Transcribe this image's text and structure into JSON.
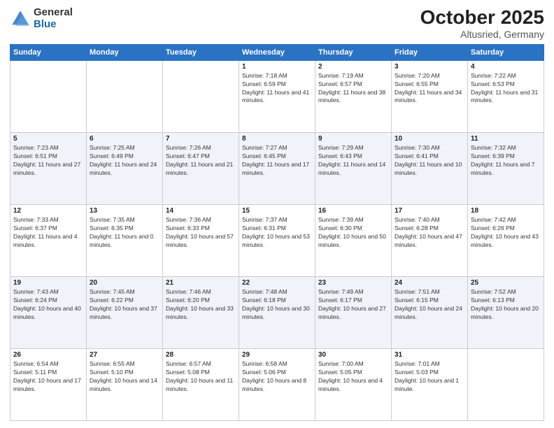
{
  "logo": {
    "general": "General",
    "blue": "Blue"
  },
  "title": {
    "month": "October 2025",
    "location": "Altusried, Germany"
  },
  "weekdays": [
    "Sunday",
    "Monday",
    "Tuesday",
    "Wednesday",
    "Thursday",
    "Friday",
    "Saturday"
  ],
  "weeks": [
    [
      {
        "day": "",
        "sunrise": "",
        "sunset": "",
        "daylight": ""
      },
      {
        "day": "",
        "sunrise": "",
        "sunset": "",
        "daylight": ""
      },
      {
        "day": "",
        "sunrise": "",
        "sunset": "",
        "daylight": ""
      },
      {
        "day": "1",
        "sunrise": "Sunrise: 7:18 AM",
        "sunset": "Sunset: 6:59 PM",
        "daylight": "Daylight: 11 hours and 41 minutes."
      },
      {
        "day": "2",
        "sunrise": "Sunrise: 7:19 AM",
        "sunset": "Sunset: 6:57 PM",
        "daylight": "Daylight: 11 hours and 38 minutes."
      },
      {
        "day": "3",
        "sunrise": "Sunrise: 7:20 AM",
        "sunset": "Sunset: 6:55 PM",
        "daylight": "Daylight: 11 hours and 34 minutes."
      },
      {
        "day": "4",
        "sunrise": "Sunrise: 7:22 AM",
        "sunset": "Sunset: 6:53 PM",
        "daylight": "Daylight: 11 hours and 31 minutes."
      }
    ],
    [
      {
        "day": "5",
        "sunrise": "Sunrise: 7:23 AM",
        "sunset": "Sunset: 6:51 PM",
        "daylight": "Daylight: 11 hours and 27 minutes."
      },
      {
        "day": "6",
        "sunrise": "Sunrise: 7:25 AM",
        "sunset": "Sunset: 6:49 PM",
        "daylight": "Daylight: 11 hours and 24 minutes."
      },
      {
        "day": "7",
        "sunrise": "Sunrise: 7:26 AM",
        "sunset": "Sunset: 6:47 PM",
        "daylight": "Daylight: 11 hours and 21 minutes."
      },
      {
        "day": "8",
        "sunrise": "Sunrise: 7:27 AM",
        "sunset": "Sunset: 6:45 PM",
        "daylight": "Daylight: 11 hours and 17 minutes."
      },
      {
        "day": "9",
        "sunrise": "Sunrise: 7:29 AM",
        "sunset": "Sunset: 6:43 PM",
        "daylight": "Daylight: 11 hours and 14 minutes."
      },
      {
        "day": "10",
        "sunrise": "Sunrise: 7:30 AM",
        "sunset": "Sunset: 6:41 PM",
        "daylight": "Daylight: 11 hours and 10 minutes."
      },
      {
        "day": "11",
        "sunrise": "Sunrise: 7:32 AM",
        "sunset": "Sunset: 6:39 PM",
        "daylight": "Daylight: 11 hours and 7 minutes."
      }
    ],
    [
      {
        "day": "12",
        "sunrise": "Sunrise: 7:33 AM",
        "sunset": "Sunset: 6:37 PM",
        "daylight": "Daylight: 11 hours and 4 minutes."
      },
      {
        "day": "13",
        "sunrise": "Sunrise: 7:35 AM",
        "sunset": "Sunset: 6:35 PM",
        "daylight": "Daylight: 11 hours and 0 minutes."
      },
      {
        "day": "14",
        "sunrise": "Sunrise: 7:36 AM",
        "sunset": "Sunset: 6:33 PM",
        "daylight": "Daylight: 10 hours and 57 minutes."
      },
      {
        "day": "15",
        "sunrise": "Sunrise: 7:37 AM",
        "sunset": "Sunset: 6:31 PM",
        "daylight": "Daylight: 10 hours and 53 minutes."
      },
      {
        "day": "16",
        "sunrise": "Sunrise: 7:39 AM",
        "sunset": "Sunset: 6:30 PM",
        "daylight": "Daylight: 10 hours and 50 minutes."
      },
      {
        "day": "17",
        "sunrise": "Sunrise: 7:40 AM",
        "sunset": "Sunset: 6:28 PM",
        "daylight": "Daylight: 10 hours and 47 minutes."
      },
      {
        "day": "18",
        "sunrise": "Sunrise: 7:42 AM",
        "sunset": "Sunset: 6:26 PM",
        "daylight": "Daylight: 10 hours and 43 minutes."
      }
    ],
    [
      {
        "day": "19",
        "sunrise": "Sunrise: 7:43 AM",
        "sunset": "Sunset: 6:24 PM",
        "daylight": "Daylight: 10 hours and 40 minutes."
      },
      {
        "day": "20",
        "sunrise": "Sunrise: 7:45 AM",
        "sunset": "Sunset: 6:22 PM",
        "daylight": "Daylight: 10 hours and 37 minutes."
      },
      {
        "day": "21",
        "sunrise": "Sunrise: 7:46 AM",
        "sunset": "Sunset: 6:20 PM",
        "daylight": "Daylight: 10 hours and 33 minutes."
      },
      {
        "day": "22",
        "sunrise": "Sunrise: 7:48 AM",
        "sunset": "Sunset: 6:18 PM",
        "daylight": "Daylight: 10 hours and 30 minutes."
      },
      {
        "day": "23",
        "sunrise": "Sunrise: 7:49 AM",
        "sunset": "Sunset: 6:17 PM",
        "daylight": "Daylight: 10 hours and 27 minutes."
      },
      {
        "day": "24",
        "sunrise": "Sunrise: 7:51 AM",
        "sunset": "Sunset: 6:15 PM",
        "daylight": "Daylight: 10 hours and 24 minutes."
      },
      {
        "day": "25",
        "sunrise": "Sunrise: 7:52 AM",
        "sunset": "Sunset: 6:13 PM",
        "daylight": "Daylight: 10 hours and 20 minutes."
      }
    ],
    [
      {
        "day": "26",
        "sunrise": "Sunrise: 6:54 AM",
        "sunset": "Sunset: 5:11 PM",
        "daylight": "Daylight: 10 hours and 17 minutes."
      },
      {
        "day": "27",
        "sunrise": "Sunrise: 6:55 AM",
        "sunset": "Sunset: 5:10 PM",
        "daylight": "Daylight: 10 hours and 14 minutes."
      },
      {
        "day": "28",
        "sunrise": "Sunrise: 6:57 AM",
        "sunset": "Sunset: 5:08 PM",
        "daylight": "Daylight: 10 hours and 11 minutes."
      },
      {
        "day": "29",
        "sunrise": "Sunrise: 6:58 AM",
        "sunset": "Sunset: 5:06 PM",
        "daylight": "Daylight: 10 hours and 8 minutes."
      },
      {
        "day": "30",
        "sunrise": "Sunrise: 7:00 AM",
        "sunset": "Sunset: 5:05 PM",
        "daylight": "Daylight: 10 hours and 4 minutes."
      },
      {
        "day": "31",
        "sunrise": "Sunrise: 7:01 AM",
        "sunset": "Sunset: 5:03 PM",
        "daylight": "Daylight: 10 hours and 1 minute."
      },
      {
        "day": "",
        "sunrise": "",
        "sunset": "",
        "daylight": ""
      }
    ]
  ]
}
